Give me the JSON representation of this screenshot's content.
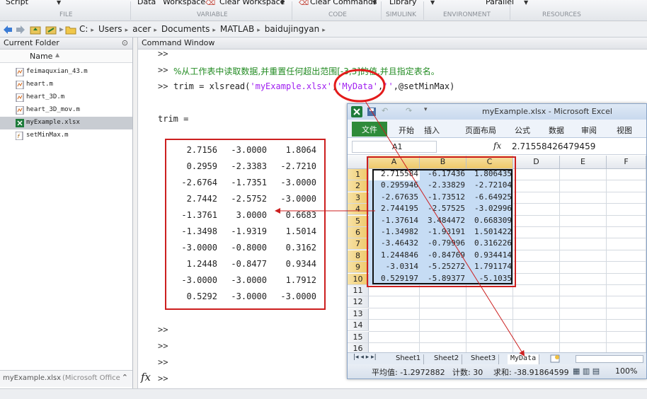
{
  "ribbon": {
    "buttons": {
      "script": "Script",
      "data": "Data",
      "workspace": "Workspace",
      "clear_workspace": "Clear Workspace",
      "clear_commands": "Clear Commands",
      "library": "Library",
      "parallel": "Parallel"
    },
    "sections": {
      "file": "FILE",
      "variable": "VARIABLE",
      "code": "CODE",
      "simulink": "SIMULINK",
      "environment": "ENVIRONMENT",
      "resources": "RESOURCES"
    }
  },
  "address": {
    "path": [
      "C:",
      "Users",
      "acer",
      "Documents",
      "MATLAB",
      "baidujingyan"
    ]
  },
  "current_folder": {
    "title": "Current Folder",
    "column_name": "Name",
    "files": [
      {
        "name": "feimaquxian_43.m",
        "icon": "m-file-icon",
        "selected": false
      },
      {
        "name": "heart.m",
        "icon": "m-file-icon",
        "selected": false
      },
      {
        "name": "heart_3D.m",
        "icon": "m-file-icon",
        "selected": false
      },
      {
        "name": "heart_3D_mov.m",
        "icon": "m-file-icon",
        "selected": false
      },
      {
        "name": "myExample.xlsx",
        "icon": "excel-file-icon",
        "selected": true
      },
      {
        "name": "setMinMax.m",
        "icon": "fx-file-icon",
        "selected": false
      }
    ],
    "details": "myExample.xlsx",
    "details_type": "(Microsoft Office"
  },
  "command_window": {
    "title": "Command Window",
    "prompt": ">>",
    "comment": "%从工作表中读取数据,并重置任何超出范围[-3,3]的值,并且指定表名。",
    "command_prefix": "trim = xlsread(",
    "arg_file": "'myExample.xlsx'",
    "arg_sep1": ",",
    "arg_sheet": "'MyData'",
    "arg_sep2": ",",
    "arg_range": "''",
    "command_suffix": ",@setMinMax)",
    "var_label": "trim =",
    "matrix": [
      [
        "2.7156",
        "-3.0000",
        "1.8064"
      ],
      [
        "0.2959",
        "-2.3383",
        "-2.7210"
      ],
      [
        "-2.6764",
        "-1.7351",
        "-3.0000"
      ],
      [
        "2.7442",
        "-2.5752",
        "-3.0000"
      ],
      [
        "-1.3761",
        "3.0000",
        "0.6683"
      ],
      [
        "-1.3498",
        "-1.9319",
        "1.5014"
      ],
      [
        "-3.0000",
        "-0.8000",
        "0.3162"
      ],
      [
        "1.2448",
        "-0.8477",
        "0.9344"
      ],
      [
        "-3.0000",
        "-3.0000",
        "1.7912"
      ],
      [
        "0.5292",
        "-3.0000",
        "-3.0000"
      ]
    ],
    "fx_label": "fx"
  },
  "excel": {
    "title": "myExample.xlsx - Microsoft Excel",
    "file_tab": "文件",
    "tabs": [
      "开始",
      "插入",
      "页面布局",
      "公式",
      "数据",
      "审阅",
      "视图"
    ],
    "name_box": "A1",
    "fx": "fx",
    "formula": "2.71558426479459",
    "columns": [
      "A",
      "B",
      "C",
      "D",
      "E",
      "F"
    ],
    "rows": [
      "1",
      "2",
      "3",
      "4",
      "5",
      "6",
      "7",
      "8",
      "9",
      "10",
      "11",
      "12",
      "13",
      "14",
      "15",
      "16"
    ],
    "cells": [
      [
        "2.715584",
        "-6.17436",
        "1.806435"
      ],
      [
        "0.295946",
        "-2.33829",
        "-2.72104"
      ],
      [
        "-2.67635",
        "-1.73512",
        "-6.64925"
      ],
      [
        "2.744195",
        "-2.57525",
        "-3.02996"
      ],
      [
        "-1.37614",
        "3.484472",
        "0.668309"
      ],
      [
        "-1.34982",
        "-1.93191",
        "1.501422"
      ],
      [
        "-3.46432",
        "-0.79996",
        "0.316226"
      ],
      [
        "1.244846",
        "-0.84769",
        "0.934414"
      ],
      [
        "-3.0314",
        "-5.25272",
        "1.791174"
      ],
      [
        "0.529197",
        "-5.89377",
        "-5.1035"
      ]
    ],
    "sheets": [
      "Sheet1",
      "Sheet2",
      "Sheet3",
      "MyData"
    ],
    "status": {
      "avg": "平均值: -1.2972882",
      "count": "计数: 30",
      "sum": "求和: -38.91864599",
      "zoom": "100%"
    }
  },
  "colors": {
    "annotation_red": "#cc1f1f",
    "excel_green": "#2e8b3a",
    "selection_blue": "#c6dcf4",
    "string_purple": "#a020f0",
    "comment_green": "#228b22"
  }
}
